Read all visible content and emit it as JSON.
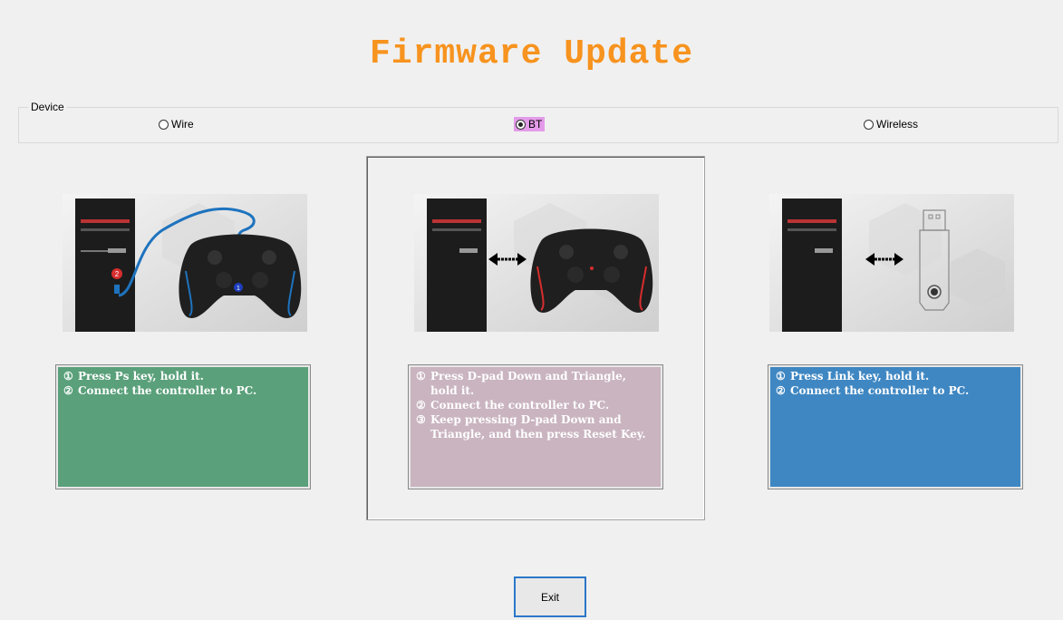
{
  "title": "Firmware Update",
  "device_group": {
    "label": "Device",
    "options": [
      {
        "label": "Wire",
        "selected": false
      },
      {
        "label": "BT",
        "selected": true
      },
      {
        "label": "Wireless",
        "selected": false
      }
    ]
  },
  "colors": {
    "title": "#f7931e",
    "wire_box": "#5aa07a",
    "bt_box": "#c9b4c0",
    "wireless_box": "#3f87c2",
    "selected_highlight": "#e39be9",
    "wire_cable": "#1e73be",
    "bt_trim": "#d62d2d"
  },
  "instructions": {
    "wire": [
      {
        "num": "①",
        "text": "Press Ps key, hold it."
      },
      {
        "num": "②",
        "text": "Connect the controller to PC."
      }
    ],
    "bt": [
      {
        "num": "①",
        "text": "Press D-pad Down and Triangle, hold it."
      },
      {
        "num": "②",
        "text": "Connect the controller to PC."
      },
      {
        "num": "③",
        "text": "Keep pressing D-pad Down and Triangle, and then press Reset Key."
      }
    ],
    "wireless": [
      {
        "num": "①",
        "text": "Press Link key, hold it."
      },
      {
        "num": "②",
        "text": "Connect the controller to PC."
      }
    ]
  },
  "illustration_badges": {
    "one": "1",
    "two": "2"
  },
  "exit_label": "Exit"
}
